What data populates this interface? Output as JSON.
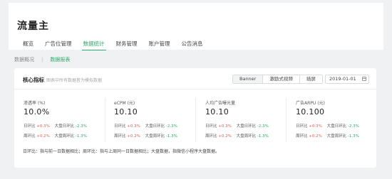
{
  "app": {
    "title": "流量主"
  },
  "nav": [
    {
      "label": "概览"
    },
    {
      "label": "广告位管理"
    },
    {
      "label": "数据统计"
    },
    {
      "label": "财务管理"
    },
    {
      "label": "账户管理"
    },
    {
      "label": "公告消息"
    }
  ],
  "nav_active_index": 2,
  "subnav": {
    "item1": "数据概况",
    "separator": "|",
    "item2": "数据报表"
  },
  "card": {
    "title": "核心指标",
    "subtitle": "图表中所有数据皆为模拟数据",
    "segments": [
      "Banner",
      "激励式视频",
      "插屏"
    ],
    "active_segment": 0,
    "date": "2019-01-01"
  },
  "metrics": [
    {
      "label": "渗透率 (%)",
      "value": "10.0%",
      "row1": {
        "a_label": "日环比",
        "a_value": "+0.3%",
        "b_label": "大盘日环比",
        "b_value": "-2.3%"
      },
      "row2": {
        "a_label": "周环比",
        "a_value": "+0.2%",
        "b_label": "大盘周环比",
        "b_value": "-1.3%"
      }
    },
    {
      "label": "eCPM (元)",
      "value": "10.10",
      "row1": {
        "a_label": "日环比",
        "a_value": "+0.3%",
        "b_label": "大盘日环比",
        "b_value": "-2.3%"
      },
      "row2": {
        "a_label": "周环比",
        "a_value": "+0.2%",
        "b_label": "大盘周环比",
        "b_value": "-1.3%"
      }
    },
    {
      "label": "人均广告曝光量",
      "value": "10.10",
      "row1": {
        "a_label": "日环比",
        "a_value": "+0.3%",
        "b_label": "大盘日环比",
        "b_value": "-2.3%"
      },
      "row2": {
        "a_label": "周环比",
        "a_value": "+0.2%",
        "b_label": "大盘周环比",
        "b_value": "-1.3%"
      }
    },
    {
      "label": "广告ARPU (元)",
      "value": "10.100",
      "row1": {
        "a_label": "日环比",
        "a_value": "+0.3%",
        "b_label": "大盘日环比",
        "b_value": "-2.3%"
      },
      "row2": {
        "a_label": "周环比",
        "a_value": "+0.2%",
        "b_label": "大盘周环比",
        "b_value": "-1.3%"
      }
    }
  ],
  "footnote": "日环比：指与前一日数据相比；周环比：指与上周同一日数据相比；大盘数据，指微信小程序大盘数据。",
  "colors": {
    "accent": "#2ca96a",
    "positive": "#e55a5a",
    "negative": "#2ca96a"
  }
}
